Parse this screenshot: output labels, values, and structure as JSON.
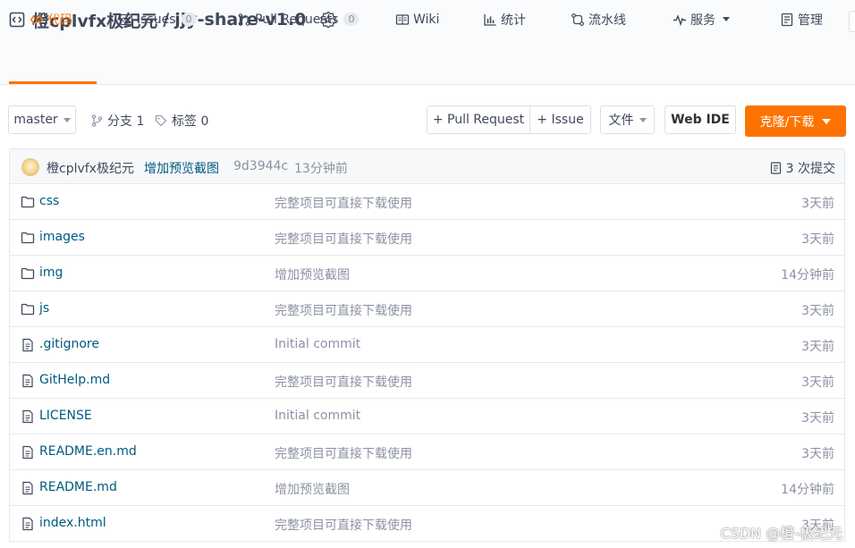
{
  "repo": {
    "owner": "橙cplvfx极纪元",
    "separator": "/",
    "name": "jjy-share-v1.0"
  },
  "tabs": [
    {
      "label": "代码",
      "icon": "code-icon",
      "active": true
    },
    {
      "label": "Issues",
      "icon": "issues-icon",
      "count": "0"
    },
    {
      "label": "Pull Requests",
      "icon": "pull-request-icon",
      "count": "0"
    },
    {
      "label": "Wiki",
      "icon": "wiki-icon"
    },
    {
      "label": "统计",
      "icon": "bar-chart-icon"
    },
    {
      "label": "流水线",
      "icon": "pipeline-icon"
    },
    {
      "label": "服务",
      "icon": "pulse-icon"
    },
    {
      "label": "管理",
      "icon": "manage-icon"
    }
  ],
  "toolbar": {
    "branch": "master",
    "branches_label": "分支 1",
    "tags_label": "标签 0",
    "new_pr": "+ Pull Request",
    "new_issue": "+ Issue",
    "file_menu": "文件",
    "web_ide": "Web IDE",
    "clone": "克隆/下载"
  },
  "commit": {
    "author": "橙cplvfx极纪元",
    "message": "增加预览截图",
    "hash": "9d3944c",
    "time": "13分钟前",
    "count_label": "3 次提交"
  },
  "files": [
    {
      "name": "css",
      "type": "folder",
      "message": "完整项目可直接下载使用",
      "time": "3天前"
    },
    {
      "name": "images",
      "type": "folder",
      "message": "完整项目可直接下载使用",
      "time": "3天前"
    },
    {
      "name": "img",
      "type": "folder",
      "message": "增加预览截图",
      "time": "14分钟前"
    },
    {
      "name": "js",
      "type": "folder",
      "message": "完整项目可直接下载使用",
      "time": "3天前"
    },
    {
      "name": ".gitignore",
      "type": "file",
      "message": "Initial commit",
      "time": "3天前"
    },
    {
      "name": "GitHelp.md",
      "type": "file",
      "message": "完整项目可直接下载使用",
      "time": "3天前"
    },
    {
      "name": "LICENSE",
      "type": "file",
      "message": "Initial commit",
      "time": "3天前"
    },
    {
      "name": "README.en.md",
      "type": "file",
      "message": "完整项目可直接下载使用",
      "time": "3天前"
    },
    {
      "name": "README.md",
      "type": "file",
      "message": "增加预览截图",
      "time": "14分钟前"
    },
    {
      "name": "index.html",
      "type": "file",
      "message": "完整项目可直接下载使用",
      "time": "3天前"
    }
  ],
  "watermark": "CSDN @橙-极纪元",
  "colors": {
    "accent": "#fe7300",
    "link": "#005980",
    "muted": "#8c92a4"
  }
}
